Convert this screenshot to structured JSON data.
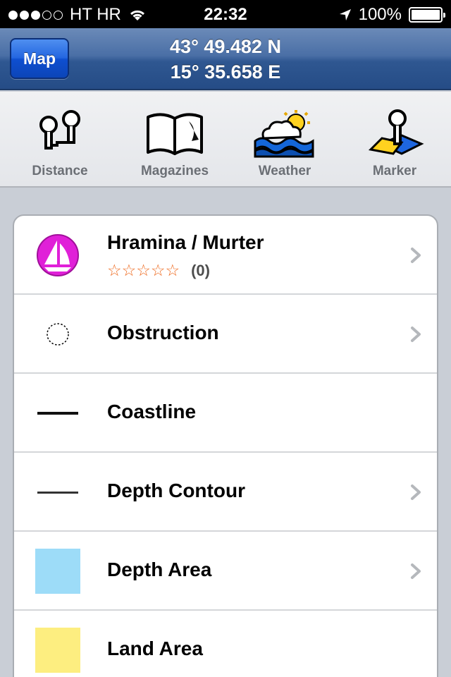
{
  "status_bar": {
    "carrier": "HT HR",
    "time": "22:32",
    "battery": "100%"
  },
  "nav": {
    "map_button": "Map",
    "latitude": "43° 49.482 N",
    "longitude": "15° 35.658 E"
  },
  "toolbar": {
    "items": [
      {
        "label": "Distance",
        "icon": "distance-icon"
      },
      {
        "label": "Magazines",
        "icon": "magazine-icon"
      },
      {
        "label": "Weather",
        "icon": "weather-icon"
      },
      {
        "label": "Marker",
        "icon": "marker-icon"
      }
    ]
  },
  "list": {
    "items": [
      {
        "title": "Hramina / Murter",
        "stars": "☆☆☆☆☆",
        "rating_count": "(0)",
        "icon": "marina-sailboat-icon",
        "accent": "#e020d8"
      },
      {
        "title": "Obstruction",
        "icon": "dotted-circle-icon"
      },
      {
        "title": "Coastline",
        "icon": "line-icon"
      },
      {
        "title": "Depth Contour",
        "icon": "line-icon"
      },
      {
        "title": "Depth Area",
        "icon": "swatch-icon",
        "color": "#9ddcf8"
      },
      {
        "title": "Land Area",
        "icon": "swatch-icon",
        "color": "#fdee80"
      }
    ]
  },
  "colors": {
    "nav_blue": "#2f5791",
    "button_blue": "#1a5ad8",
    "star_orange": "#ee6a1f"
  }
}
